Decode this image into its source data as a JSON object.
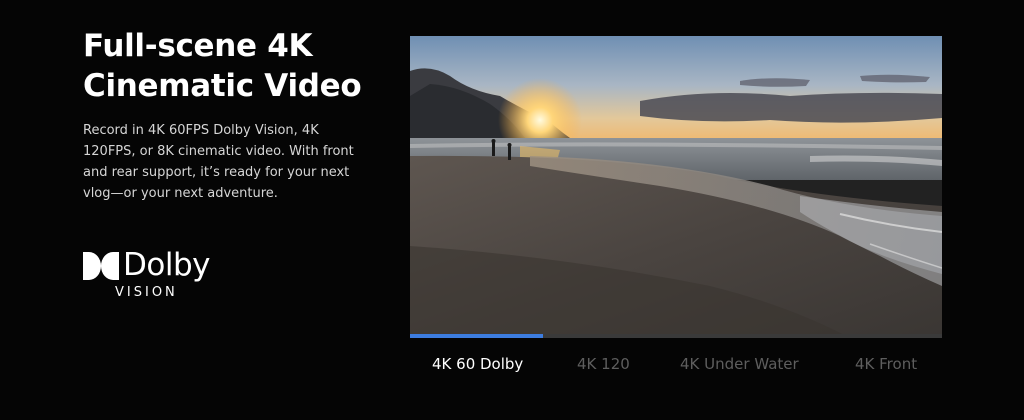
{
  "hero": {
    "title_line1": "Full-scene 4K",
    "title_line2": "Cinematic Video",
    "description": "Record in 4K 60FPS Dolby Vision, 4K 120FPS, or 8K cinematic video. With front and rear support, it’s ready for your next vlog—or your next adventure."
  },
  "logo": {
    "icon": "dolby-double-d-icon",
    "word": "Dolby",
    "sub": "VISION"
  },
  "video": {
    "scene": "sunset beach shoreline with two people walking",
    "progress_fraction": 0.25,
    "progress_color": "#3d7de0"
  },
  "tabs": [
    {
      "label": "4K 60 Dolby",
      "active": true
    },
    {
      "label": "4K 120",
      "active": false
    },
    {
      "label": "4K Under Water",
      "active": false
    },
    {
      "label": "4K Front",
      "active": false
    }
  ]
}
